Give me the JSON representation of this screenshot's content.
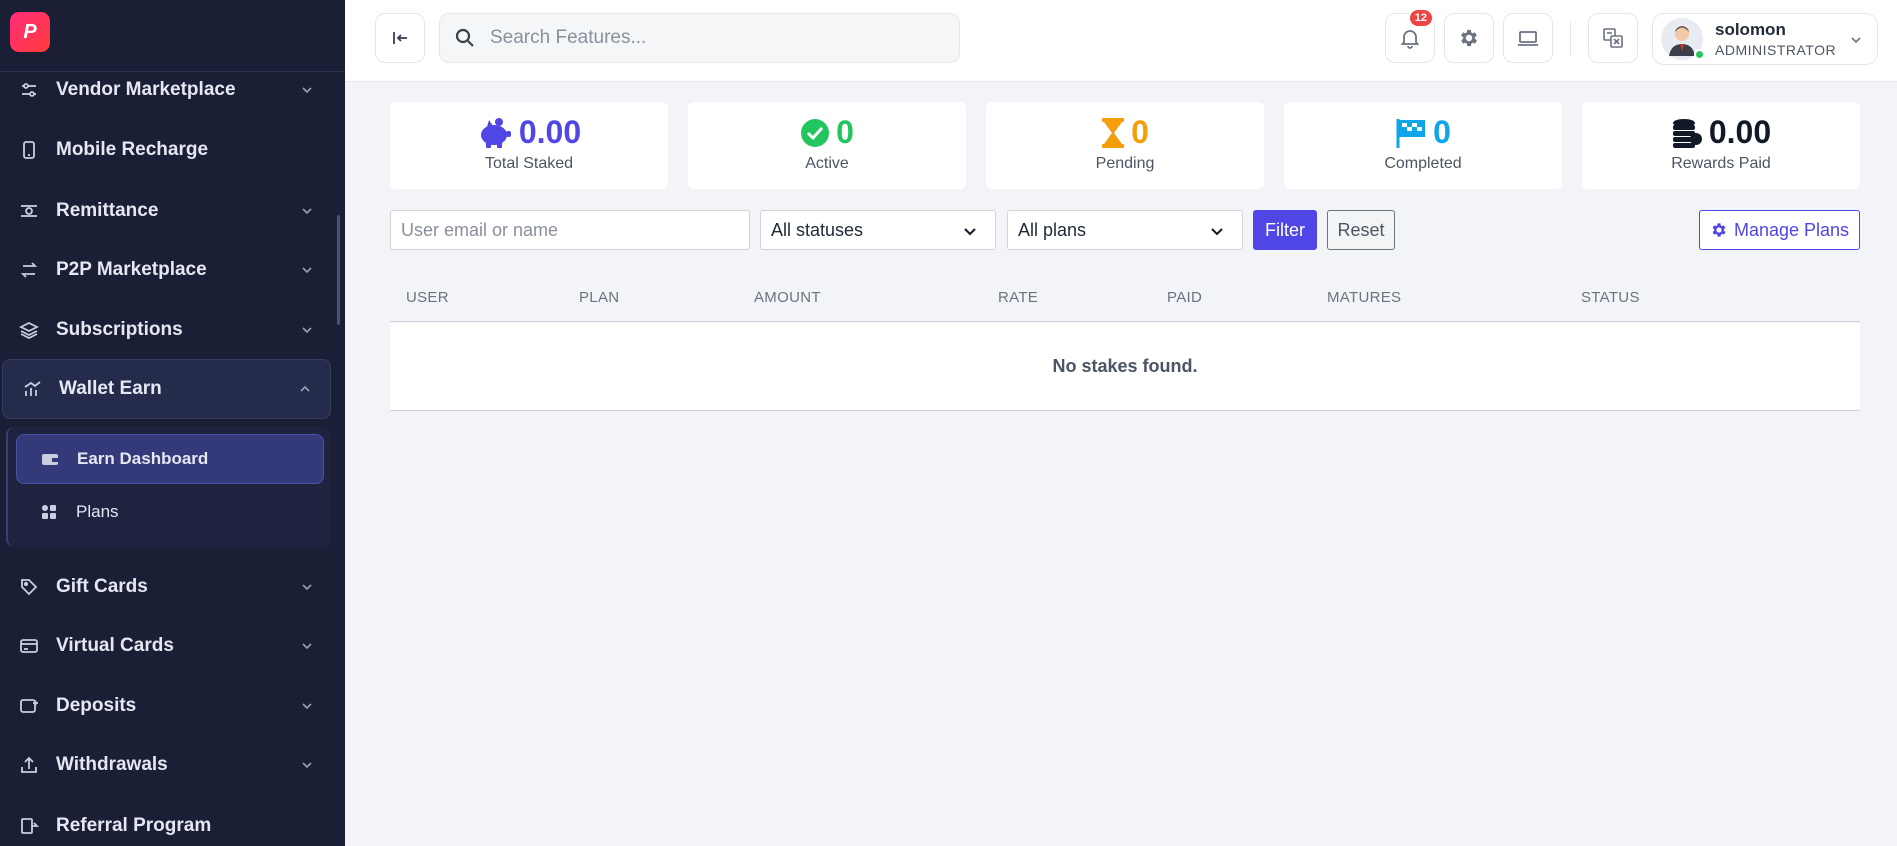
{
  "sidebar": {
    "items": [
      {
        "label": "Vendor Marketplace",
        "icon": "sliders-icon"
      },
      {
        "label": "Mobile Recharge",
        "icon": "phone-icon"
      },
      {
        "label": "Remittance",
        "icon": "money-transfer-icon"
      },
      {
        "label": "P2P Marketplace",
        "icon": "exchange-icon"
      },
      {
        "label": "Subscriptions",
        "icon": "layers-icon"
      },
      {
        "label": "Wallet Earn",
        "icon": "chart-icon"
      },
      {
        "label": "Gift Cards",
        "icon": "tag-icon"
      },
      {
        "label": "Virtual Cards",
        "icon": "card-icon"
      },
      {
        "label": "Deposits",
        "icon": "deposit-icon"
      },
      {
        "label": "Withdrawals",
        "icon": "upload-icon"
      },
      {
        "label": "Referral Program",
        "icon": "referral-icon"
      }
    ],
    "sub_items": [
      {
        "label": "Earn Dashboard",
        "icon": "wallet-icon"
      },
      {
        "label": "Plans",
        "icon": "grid-icon"
      }
    ]
  },
  "header": {
    "search_placeholder": "Search Features...",
    "notification_count": "12",
    "user_name": "solomon",
    "user_role": "ADMINISTRATOR"
  },
  "stats": [
    {
      "value": "0.00",
      "label": "Total Staked",
      "color": "#4f46e5",
      "icon": "piggy-bank-icon"
    },
    {
      "value": "0",
      "label": "Active",
      "color": "#22c55e",
      "icon": "check-circle-icon"
    },
    {
      "value": "0",
      "label": "Pending",
      "color": "#f59e0b",
      "icon": "hourglass-icon"
    },
    {
      "value": "0",
      "label": "Completed",
      "color": "#0ea5e9",
      "icon": "flag-icon"
    },
    {
      "value": "0.00",
      "label": "Rewards Paid",
      "color": "#111827",
      "icon": "coins-icon"
    }
  ],
  "filters": {
    "user_placeholder": "User email or name",
    "status_selected": "All statuses",
    "plan_selected": "All plans",
    "filter_label": "Filter",
    "reset_label": "Reset",
    "manage_label": "Manage Plans"
  },
  "table": {
    "columns": [
      "USER",
      "PLAN",
      "AMOUNT",
      "RATE",
      "PAID",
      "MATURES",
      "STATUS"
    ],
    "empty_message": "No stakes found."
  },
  "colors": {
    "sidebar_bg": "#1a1f36",
    "accent": "#4f46e5"
  }
}
